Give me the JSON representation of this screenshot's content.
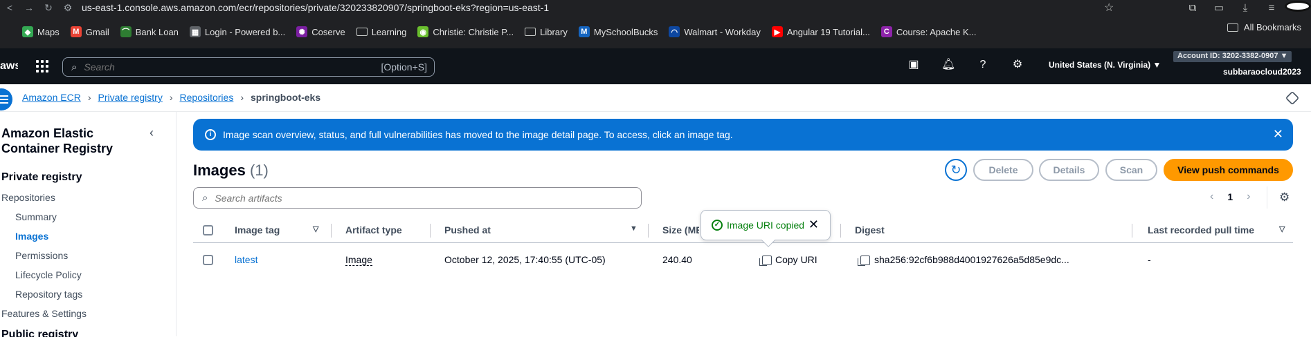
{
  "browser": {
    "url": "us-east-1.console.aws.amazon.com/ecr/repositories/private/320233820907/springboot-eks?region=us-east-1",
    "bookmarks": [
      "Maps",
      "Gmail",
      "Bank Loan",
      "Login - Powered b...",
      "Coserve",
      "Learning",
      "Christie: Christie P...",
      "Library",
      "MySchoolBucks",
      "Walmart - Workday",
      "Angular 19 Tutorial...",
      "Course: Apache K..."
    ],
    "all_bookmarks": "All Bookmarks"
  },
  "awsnav": {
    "logo": "aws",
    "search_placeholder": "Search",
    "search_shortcut": "[Option+S]",
    "region": "United States (N. Virginia) ▼",
    "account_id": "Account ID: 3202-3382-0907 ▼",
    "username": "subbaraocloud2023"
  },
  "breadcrumb": {
    "items": [
      "Amazon ECR",
      "Private registry",
      "Repositories"
    ],
    "current": "springboot-eks"
  },
  "sidebar": {
    "title": "Amazon Elastic Container Registry",
    "section": "Private registry",
    "repositories": "Repositories",
    "subitems": [
      "Summary",
      "Images",
      "Permissions",
      "Lifecycle Policy",
      "Repository tags"
    ],
    "active": "Images",
    "features": "Features & Settings",
    "public_partial": "Public registry"
  },
  "flash": {
    "message": "Image scan overview, status, and full vulnerabilities has moved to the image detail page. To access, click an image tag."
  },
  "images": {
    "title": "Images",
    "count": "(1)",
    "buttons": {
      "delete": "Delete",
      "details": "Details",
      "scan": "Scan",
      "push": "View push commands"
    },
    "search_placeholder": "Search artifacts",
    "page": "1"
  },
  "table": {
    "headers": [
      "Image tag",
      "Artifact type",
      "Pushed at",
      "Size (MB)",
      "Digest",
      "Last recorded pull time"
    ],
    "rows": [
      {
        "tag": "latest",
        "type": "Image",
        "pushed": "October 12, 2025, 17:40:55 (UTC-05)",
        "size": "240.40",
        "copy_uri": "Copy URI",
        "digest": "sha256:92cf6b988d4001927626a5d85e9dc...",
        "last_pull": "-"
      }
    ]
  },
  "popover": {
    "text": "Image URI copied"
  },
  "colors": {
    "primary_blue": "#0972d3",
    "orange": "#ff9900",
    "nav_dark": "#0f141a",
    "success_green": "#037f0c"
  }
}
